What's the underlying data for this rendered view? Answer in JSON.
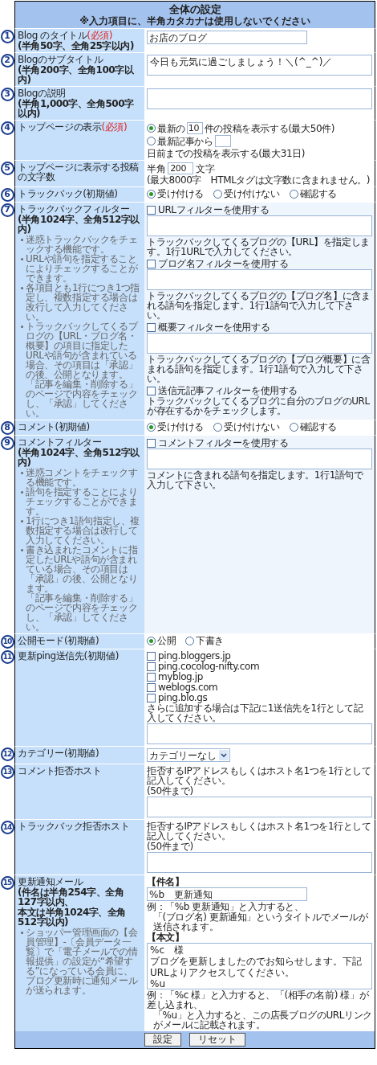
{
  "header": {
    "title": "全体の設定",
    "note": "※入力項目に、半角カタカナは使用しないでください"
  },
  "rows": [
    {
      "number": "1",
      "label": "Blog のタイトル",
      "required": "(必須)",
      "limit": [
        "(半角50字、全角25字以内)"
      ],
      "controls": [
        {
          "kind": "text",
          "value": "お店のブログ"
        }
      ]
    },
    {
      "number": "2",
      "label": "Blogのサブタイトル",
      "limit": [
        "(半角200字、全角100字以内)"
      ],
      "controls": [
        {
          "kind": "textarea",
          "value": "今日も元気に過ごしましょう！＼(^_^)／"
        }
      ]
    },
    {
      "number": "3",
      "label": "Blogの説明",
      "limit": [
        "(半角1,000字、全角500字以内)"
      ],
      "controls": [
        {
          "kind": "textarea"
        }
      ]
    },
    {
      "number": "4",
      "label": "トップページの表示",
      "required": "(必須)",
      "controls": [
        {
          "kind": "radio_rows",
          "options": [
            {
              "selected": true,
              "before": "最新の",
              "value": "10",
              "after": "件の投稿を表示する(最大50件)"
            },
            {
              "selected": false,
              "before": "最新記事から",
              "after": "日前までの投稿を表示する(最大31日)"
            }
          ]
        }
      ]
    },
    {
      "number": "5",
      "label": "トップページに表示する投稿の文字数",
      "controls": [
        {
          "kind": "inline_field",
          "before": "半角",
          "value": "200",
          "after": "文字"
        },
        {
          "kind": "text_line",
          "text": "(最大8000字　HTMLタグは文字数に含まれません。)"
        }
      ]
    },
    {
      "number": "6",
      "label": "トラックバック(初期値)",
      "controls": [
        {
          "kind": "radios",
          "options": [
            {
              "label": "受け付ける",
              "selected": true
            },
            {
              "label": "受け付けない",
              "selected": false
            },
            {
              "label": "確認する",
              "selected": false
            }
          ]
        }
      ]
    },
    {
      "number": "7",
      "label": "トラックバックフィルター",
      "limit": [
        "(半角1024字、全角512字以内)"
      ],
      "bullets": [
        [
          "迷惑トラックバックをチェックする機能です。"
        ],
        [
          "URLや語句を指定することによりチェックすることができます。"
        ],
        [
          "各項目とも1行につき1つ指定し、複数指定する場合は改行して入力してください。"
        ],
        [
          "トラックバックしてくるブログの【URL・ブログ名・概要】の項目に指定したURLや語句が含まれている場合、その項目は「承認」の後、公開となります。",
          "「記事を編集・削除する」のページで内容をチェックし、「承認」してください。"
        ]
      ],
      "controls": [
        {
          "kind": "filter",
          "label": "URLフィルターを使用する",
          "checked": false,
          "note": "トラックバックしてくるブログの【URL】を指定します。1行1URLで入力してください。"
        },
        {
          "kind": "filter",
          "label": "ブログ名フィルターを使用する",
          "checked": false,
          "note": "トラックバックしてくるブログの【ブログ名】に含まれる語句を指定します。1行1語句で入力して下さい。"
        },
        {
          "kind": "filter",
          "label": "概要フィルターを使用する",
          "checked": false,
          "note": "トラックバックしてくるブログの【ブログ概要】に含まれる語句を指定します。1行1語句で入力して下さい。"
        },
        {
          "kind": "checkbox",
          "label": "送信元記事フィルターを使用する",
          "checked": false,
          "note": "トラックバックしてくるブログに自分のブログのURLが存在するかをチェックします。"
        }
      ]
    },
    {
      "number": "8",
      "label": "コメント(初期値)",
      "controls": [
        {
          "kind": "radios",
          "options": [
            {
              "label": "受け付ける",
              "selected": true
            },
            {
              "label": "受け付けない",
              "selected": false
            },
            {
              "label": "確認する",
              "selected": false
            }
          ]
        }
      ]
    },
    {
      "number": "9",
      "label": "コメントフィルター",
      "limit": [
        "(半角1024字、全角512字以内)"
      ],
      "bullets": [
        [
          "迷惑コメントをチェックする機能です。"
        ],
        [
          "語句を指定することによりチェックすることができます。"
        ],
        [
          "1行につき1語句指定し、複数指定する場合は改行して入力してください。"
        ],
        [
          "書き込まれたコメントに指定したURLや語句が含まれている場合、その項目は「承認」の後、公開となります。",
          "「記事を編集・削除する」のページで内容をチェックし、「承認」してください。"
        ]
      ],
      "controls": [
        {
          "kind": "filter",
          "label": "コメントフィルターを使用する",
          "checked": false,
          "note": "コメントに含まれる語句を指定します。1行1語句で入力して下さい。"
        }
      ]
    },
    {
      "number": "10",
      "label": "公開モード(初期値)",
      "controls": [
        {
          "kind": "radios",
          "options": [
            {
              "label": "公開",
              "selected": true
            },
            {
              "label": "下書き",
              "selected": false
            }
          ]
        }
      ]
    },
    {
      "number": "11",
      "label": "更新ping送信先(初期値)",
      "controls": [
        {
          "kind": "checkboxes",
          "items": [
            {
              "label": "ping.bloggers.jp",
              "checked": false
            },
            {
              "label": "ping.cocolog-nifty.com",
              "checked": false
            },
            {
              "label": "myblog.jp",
              "checked": false
            },
            {
              "label": "weblogs.com",
              "checked": false
            },
            {
              "label": "ping.blo.gs",
              "checked": false
            }
          ]
        },
        {
          "kind": "note",
          "lines": [
            "さらに追加する場合は下記に1送信先を1行として記入してください。"
          ]
        },
        {
          "kind": "textarea"
        }
      ]
    },
    {
      "number": "12",
      "label": "カテゴリー(初期値)",
      "controls": [
        {
          "kind": "select",
          "value": "カテゴリーなし"
        }
      ]
    },
    {
      "number": "13",
      "label": "コメント拒否ホスト",
      "controls": [
        {
          "kind": "note",
          "lines": [
            "拒否するIPアドレスもしくはホスト名1つを1行として記入してください。"
          ]
        },
        {
          "kind": "note",
          "lines": [
            "(50件まで)"
          ]
        },
        {
          "kind": "textarea"
        }
      ]
    },
    {
      "number": "14",
      "label": "トラックバック拒否ホスト",
      "controls": [
        {
          "kind": "note",
          "lines": [
            "拒否するIPアドレスもしくはホスト名1つを1行として記入してください。"
          ]
        },
        {
          "kind": "note",
          "lines": [
            "(50件まで)"
          ]
        },
        {
          "kind": "textarea"
        }
      ]
    },
    {
      "number": "15",
      "label": "更新通知メール",
      "limit": [
        "(件名は半角254字、全角127字以内、",
        "本文は半角1024字、全角512字以内)"
      ],
      "bullets": [
        [
          "ショッパー管理画面の【会員管理】-〔会員データ一覧〕で「電子メールでの情報提供」の設定が“希望する”になっている会員に、ブログ更新時に通知メールが送られます。"
        ]
      ],
      "controls": [
        {
          "kind": "heading",
          "text": "【件名】"
        },
        {
          "kind": "text",
          "value": "%b　更新通知"
        },
        {
          "kind": "note",
          "lines": [
            "例：「%b 更新通知」と入力すると、",
            "「(ブログ名) 更新通知」というタイトルでメールが送信されます。"
          ]
        },
        {
          "kind": "heading",
          "text": "【本文】"
        },
        {
          "kind": "textarea",
          "lines": [
            "%c　様",
            "ブログを更新しましたのでお知らせします。下記URLよりアクセスしてください。",
            "%u"
          ]
        },
        {
          "kind": "note",
          "lines": [
            "例：「%c 様」と入力すると、「(相手の名前) 様」が差し込まれ、",
            "「%u」と入力すると、この店長ブログのURLリンクがメールに記載されます。"
          ]
        }
      ]
    }
  ],
  "buttons": [
    {
      "label": "設定"
    },
    {
      "label": "リセット"
    }
  ]
}
